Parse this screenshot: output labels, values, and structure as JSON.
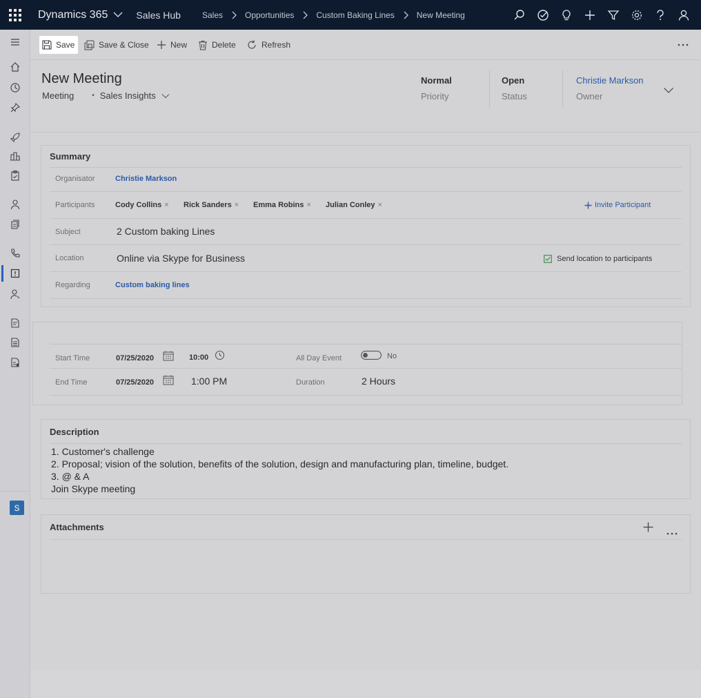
{
  "topbar": {
    "brand": "Dynamics 365",
    "app": "Sales Hub",
    "breadcrumb": [
      "Sales",
      "Opportunities",
      "Custom Baking Lines",
      "New Meeting"
    ]
  },
  "icons": {
    "top": [
      "search-icon",
      "task-check-icon",
      "lightbulb-icon",
      "plus-icon",
      "filter-icon",
      "gear-icon",
      "help-icon",
      "user-icon"
    ],
    "rail": [
      "menu-icon",
      "home-icon",
      "recent-icon",
      "pin-icon",
      "rocket-icon",
      "dashboard-icon",
      "clipboard-icon",
      "contact-icon",
      "account-icon",
      "phone-icon",
      "activity-icon",
      "lead-icon",
      "quote-icon",
      "document-icon",
      "invoice-icon"
    ]
  },
  "rail": {
    "app_badge": "S"
  },
  "commands": {
    "save": "Save",
    "save_close": "Save & Close",
    "new": "New",
    "delete": "Delete",
    "refresh": "Refresh"
  },
  "header": {
    "title": "New Meeting",
    "entity": "Meeting",
    "form_name": "Sales Insights",
    "priority": {
      "value": "Normal",
      "label": "Priority"
    },
    "status": {
      "value": "Open",
      "label": "Status"
    },
    "owner": {
      "value": "Christie Markson",
      "label": "Owner"
    }
  },
  "summary": {
    "title": "Summary",
    "organiser_label": "Organisator",
    "organiser": "Christie Markson",
    "participants_label": "Participants",
    "participants": [
      "Cody Collins",
      "Rick Sanders",
      "Emma Robins",
      "Julian Conley"
    ],
    "invite": "Invite Participant",
    "subject_label": "Subject",
    "subject": "2 Custom baking Lines",
    "location_label": "Location",
    "location": "Online via Skype for Business",
    "send_location": "Send location to participants",
    "regarding_label": "Regarding",
    "regarding": "Custom baking lines"
  },
  "schedule": {
    "start_label": "Start Time",
    "start_date": "07/25/2020",
    "start_time": "10:00",
    "allday_label": "All Day Event",
    "allday_value": "No",
    "end_label": "End Time",
    "end_date": "07/25/2020",
    "end_time": "1:00 PM",
    "duration_label": "Duration",
    "duration": "2 Hours"
  },
  "description": {
    "title": "Description",
    "lines": [
      "1. Customer's challenge",
      "2. Proposal; vision of the solution, benefits of the solution, design and manufacturing plan, timeline, budget.",
      "3. @ & A",
      "Join Skype meeting"
    ]
  },
  "attachments": {
    "title": "Attachments"
  }
}
